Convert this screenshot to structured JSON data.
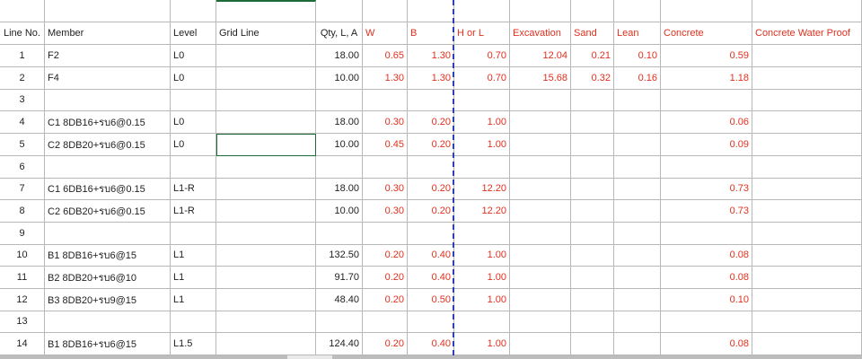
{
  "headers": {
    "line_no": "Line No.",
    "member": "Member",
    "level": "Level",
    "grid_line": "Grid Line",
    "qty": "Qty, L, A",
    "w": "W",
    "b": "B",
    "h": "H or L",
    "excavation": "Excavation",
    "sand": "Sand",
    "lean": "Lean",
    "concrete": "Concrete",
    "waterproof": "Concrete Water Proof"
  },
  "rows": [
    {
      "line": "1",
      "member": "F2",
      "level": "L0",
      "grid": "",
      "qty": "18.00",
      "w": "0.65",
      "b": "1.30",
      "h": "0.70",
      "exc": "12.04",
      "sand": "0.21",
      "lean": "0.10",
      "conc": "0.59",
      "wp": ""
    },
    {
      "line": "2",
      "member": "F4",
      "level": "L0",
      "grid": "",
      "qty": "10.00",
      "w": "1.30",
      "b": "1.30",
      "h": "0.70",
      "exc": "15.68",
      "sand": "0.32",
      "lean": "0.16",
      "conc": "1.18",
      "wp": ""
    },
    {
      "line": "3",
      "member": "",
      "level": "",
      "grid": "",
      "qty": "",
      "w": "",
      "b": "",
      "h": "",
      "exc": "",
      "sand": "",
      "lean": "",
      "conc": "",
      "wp": ""
    },
    {
      "line": "4",
      "member": "C1 8DB16+รบ6@0.15",
      "level": "L0",
      "grid": "",
      "qty": "18.00",
      "w": "0.30",
      "b": "0.20",
      "h": "1.00",
      "exc": "",
      "sand": "",
      "lean": "",
      "conc": "0.06",
      "wp": ""
    },
    {
      "line": "5",
      "member": "C2 8DB20+รบ6@0.15",
      "level": "L0",
      "grid": "",
      "qty": "10.00",
      "w": "0.45",
      "b": "0.20",
      "h": "1.00",
      "exc": "",
      "sand": "",
      "lean": "",
      "conc": "0.09",
      "wp": ""
    },
    {
      "line": "6",
      "member": "",
      "level": "",
      "grid": "",
      "qty": "",
      "w": "",
      "b": "",
      "h": "",
      "exc": "",
      "sand": "",
      "lean": "",
      "conc": "",
      "wp": ""
    },
    {
      "line": "7",
      "member": "C1 6DB16+รบ6@0.15",
      "level": "L1-R",
      "grid": "",
      "qty": "18.00",
      "w": "0.30",
      "b": "0.20",
      "h": "12.20",
      "exc": "",
      "sand": "",
      "lean": "",
      "conc": "0.73",
      "wp": ""
    },
    {
      "line": "8",
      "member": "C2 6DB20+รบ6@0.15",
      "level": "L1-R",
      "grid": "",
      "qty": "10.00",
      "w": "0.30",
      "b": "0.20",
      "h": "12.20",
      "exc": "",
      "sand": "",
      "lean": "",
      "conc": "0.73",
      "wp": ""
    },
    {
      "line": "9",
      "member": "",
      "level": "",
      "grid": "",
      "qty": "",
      "w": "",
      "b": "",
      "h": "",
      "exc": "",
      "sand": "",
      "lean": "",
      "conc": "",
      "wp": ""
    },
    {
      "line": "10",
      "member": "B1 8DB16+รบ6@15",
      "level": "L1",
      "grid": "",
      "qty": "132.50",
      "w": "0.20",
      "b": "0.40",
      "h": "1.00",
      "exc": "",
      "sand": "",
      "lean": "",
      "conc": "0.08",
      "wp": ""
    },
    {
      "line": "11",
      "member": "B2 8DB20+รบ6@10",
      "level": "L1",
      "grid": "",
      "qty": "91.70",
      "w": "0.20",
      "b": "0.40",
      "h": "1.00",
      "exc": "",
      "sand": "",
      "lean": "",
      "conc": "0.08",
      "wp": ""
    },
    {
      "line": "12",
      "member": "B3 8DB20+รบ9@15",
      "level": "L1",
      "grid": "",
      "qty": "48.40",
      "w": "0.20",
      "b": "0.50",
      "h": "1.00",
      "exc": "",
      "sand": "",
      "lean": "",
      "conc": "0.10",
      "wp": ""
    },
    {
      "line": "13",
      "member": "",
      "level": "",
      "grid": "",
      "qty": "",
      "w": "",
      "b": "",
      "h": "",
      "exc": "",
      "sand": "",
      "lean": "",
      "conc": "",
      "wp": ""
    },
    {
      "line": "14",
      "member": "B1 8DB16+รบ6@15",
      "level": "L1.5",
      "grid": "",
      "qty": "124.40",
      "w": "0.20",
      "b": "0.40",
      "h": "1.00",
      "exc": "",
      "sand": "",
      "lean": "",
      "conc": "0.08",
      "wp": ""
    }
  ],
  "colors": {
    "red_text": "#e0301e",
    "grid_border": "#b8b8b8",
    "active_cell_border": "#1e6b3a",
    "page_break_line": "#2b3fb8"
  }
}
